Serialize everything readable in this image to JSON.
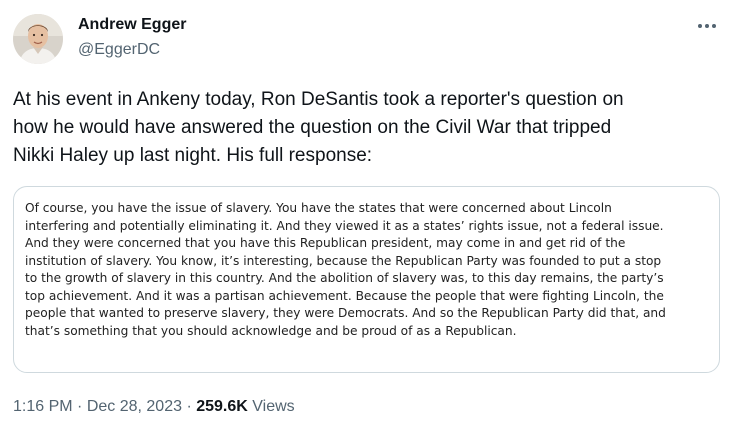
{
  "author": {
    "name": "Andrew Egger",
    "handle": "@EggerDC"
  },
  "tweet": {
    "text_lines": [
      "At his event in Ankeny today, Ron DeSantis took a reporter's question on",
      "how he would have answered the question on the Civil War that tripped",
      "Nikki Haley up last night. His full response:"
    ]
  },
  "quote": {
    "lines": [
      "Of course, you have the issue of slavery. You have the states that were concerned about Lincoln",
      "interfering and potentially eliminating it. And they viewed it as a states’ rights issue, not a federal issue.",
      "And they were concerned that you have this Republican president, may come in and get rid of the",
      "institution of slavery. You know, it’s interesting, because the Republican Party was founded to put a stop",
      "to the growth of slavery in this country. And the abolition of slavery was, to this day remains, the party’s",
      "top achievement. And it was a partisan achievement. Because the people that were fighting Lincoln, the",
      "people that wanted to preserve slavery, they were Democrats. And so the Republican Party did that, and",
      "that’s something that you should acknowledge and be proud of as a Republican."
    ]
  },
  "meta": {
    "time": "1:16 PM",
    "sep1": " · ",
    "date": "Dec 28, 2023",
    "sep2": " · ",
    "views_count": "259.6K",
    "views_label": " Views"
  },
  "icons": {
    "more": "more-options-icon",
    "avatar": "profile-photo"
  },
  "colors": {
    "text_primary": "#0f1419",
    "text_secondary": "#536471",
    "border": "#cfd9de"
  }
}
